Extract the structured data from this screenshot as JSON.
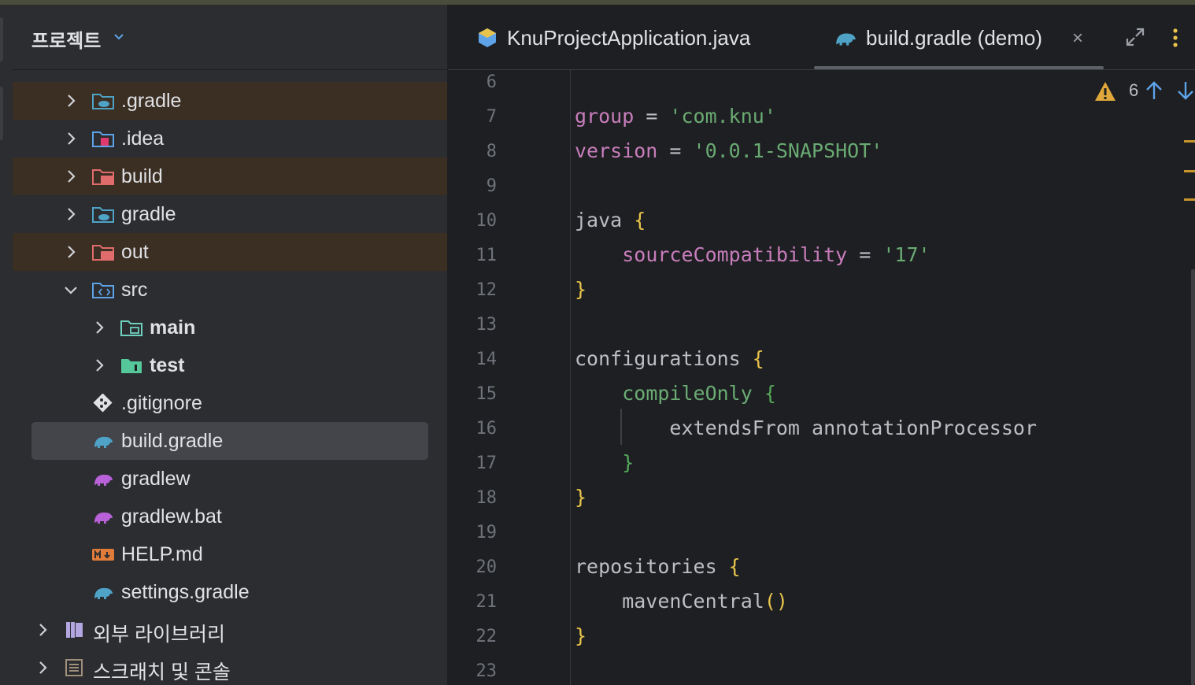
{
  "project_panel": {
    "title": "프로젝트",
    "cut_row_text": "",
    "items": [
      {
        "label": ".gradle",
        "icon": "gradle-folder-icon",
        "expanded": false
      },
      {
        "label": ".idea",
        "icon": "idea-folder-icon",
        "expanded": false
      },
      {
        "label": "build",
        "icon": "excluded-folder-icon",
        "expanded": false
      },
      {
        "label": "gradle",
        "icon": "gradle-folder-icon",
        "expanded": false
      },
      {
        "label": "out",
        "icon": "excluded-folder-icon",
        "expanded": false
      },
      {
        "label": "src",
        "icon": "source-folder-icon",
        "expanded": true
      },
      {
        "label": "main",
        "icon": "module-folder-icon",
        "expanded": false
      },
      {
        "label": "test",
        "icon": "test-folder-icon",
        "expanded": false
      },
      {
        "label": ".gitignore",
        "icon": "git-icon"
      },
      {
        "label": "build.gradle",
        "icon": "gradle-file-icon",
        "selected": true
      },
      {
        "label": "gradlew",
        "icon": "gradlew-icon"
      },
      {
        "label": "gradlew.bat",
        "icon": "gradlew-icon"
      },
      {
        "label": "HELP.md",
        "icon": "markdown-icon"
      },
      {
        "label": "settings.gradle",
        "icon": "gradle-file-icon"
      },
      {
        "label": "외부 라이브러리",
        "icon": "library-icon",
        "expanded": false
      },
      {
        "label": "스크래치 및 콘솔",
        "icon": "scratch-icon",
        "expanded": false
      }
    ]
  },
  "editor": {
    "tabs": [
      {
        "label": "KnuProjectApplication.java",
        "icon": "java-class-icon",
        "active": false
      },
      {
        "label": "build.gradle (demo)",
        "icon": "gradle-file-icon",
        "active": true,
        "close": "×"
      }
    ],
    "inspection": {
      "icon": "warning-icon",
      "count": "6"
    },
    "line_numbers": [
      "6",
      "7",
      "8",
      "9",
      "10",
      "11",
      "12",
      "13",
      "14",
      "15",
      "16",
      "17",
      "18",
      "19",
      "20",
      "21",
      "22",
      "23"
    ],
    "code": {
      "l7_prop": "group",
      "l7_op": " = ",
      "l7_str": "'com.knu'",
      "l8_prop": "version",
      "l8_op": " = ",
      "l8_str": "'0.0.1-SNAPSHOT'",
      "l10_text": "java ",
      "l10_brace": "{",
      "l11_indent": "    ",
      "l11_prop": "sourceCompatibility",
      "l11_op": " = ",
      "l11_str": "'17'",
      "l12_brace": "}",
      "l14_text": "configurations ",
      "l14_brace": "{",
      "l15_indent": "    ",
      "l15_text": "compileOnly ",
      "l15_brace": "{",
      "l16_text": "        extendsFrom annotationProcessor",
      "l17_indent": "    ",
      "l17_brace": "}",
      "l18_brace": "}",
      "l20_text": "repositories ",
      "l20_brace": "{",
      "l21_text": "    mavenCentral",
      "l21_paren": "()",
      "l22_brace": "}"
    }
  },
  "colors": {
    "background": "#1e1f22",
    "panel": "#2b2d30",
    "excluded_row": "#3b2e22",
    "selected_row": "#43454a",
    "property": "#c77dbb",
    "string": "#6aab73",
    "brace": "#e8c34b",
    "warning": "#e0a83a"
  }
}
